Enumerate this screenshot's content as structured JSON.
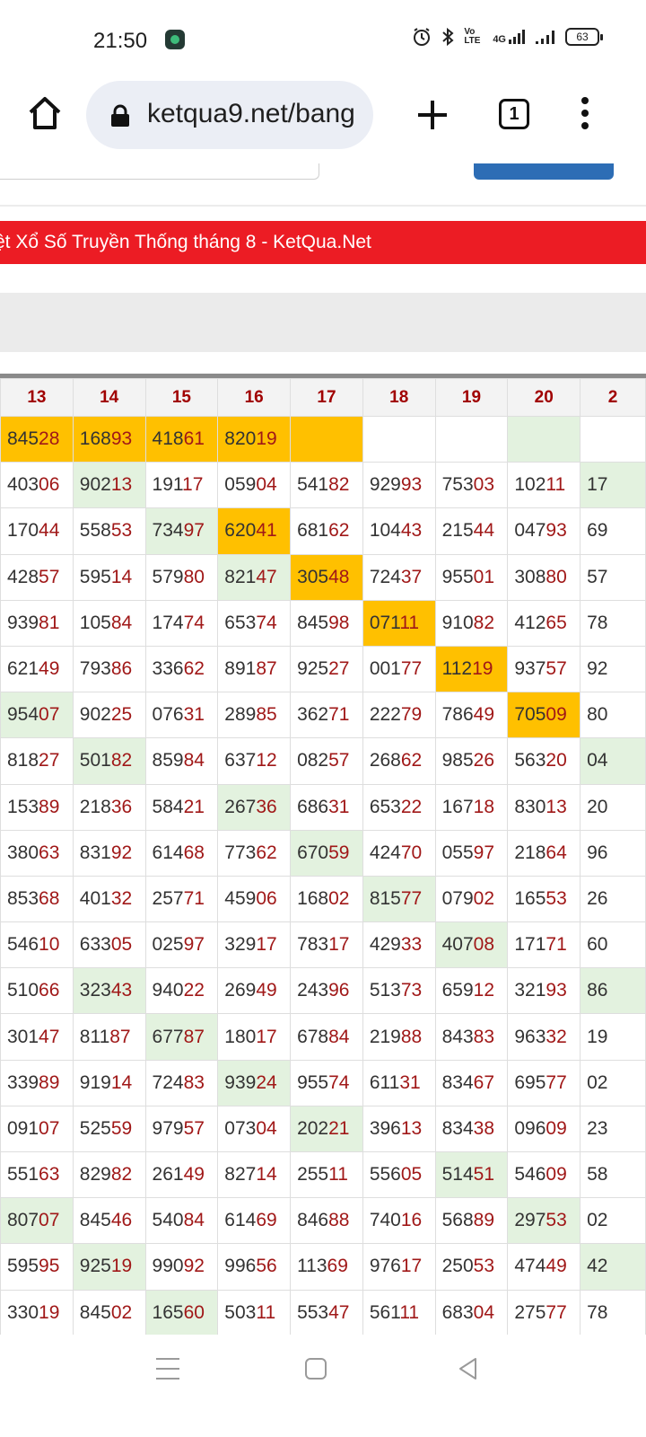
{
  "status_bar": {
    "time": "21:50",
    "network_label": "4G",
    "volte_label": "Vo LTE",
    "battery": "63",
    "icons": [
      "app-notification-icon",
      "alarm-icon",
      "bluetooth-icon",
      "volte-icon",
      "signal-4g-icon",
      "signal-icon",
      "battery-icon"
    ]
  },
  "toolbar": {
    "url": "ketqua9.net/bang",
    "tab_count": "1",
    "icons": [
      "home-icon",
      "lock-icon",
      "plus-icon",
      "tabs-icon",
      "menu-icon"
    ]
  },
  "banner": {
    "text": "ệt Xổ Số Truyền Thống tháng 8 - KetQua.Net",
    "color": "#ec1c24"
  },
  "colors": {
    "highlight_orange": "#ffc000",
    "highlight_green": "#e3f2df",
    "tail_digits": "#a01818",
    "header_text": "#a00000"
  },
  "table": {
    "headers": [
      "13",
      "14",
      "15",
      "16",
      "17",
      "18",
      "19",
      "20",
      "2"
    ],
    "rows": [
      [
        {
          "v": "84528",
          "h": "o"
        },
        {
          "v": "16893",
          "h": "o"
        },
        {
          "v": "41861",
          "h": "o"
        },
        {
          "v": "82019",
          "h": "o"
        },
        {
          "v": "",
          "h": "o"
        },
        {
          "v": "",
          "h": ""
        },
        {
          "v": "",
          "h": ""
        },
        {
          "v": "",
          "h": "g"
        },
        {
          "v": "",
          "h": ""
        }
      ],
      [
        {
          "v": "40306",
          "h": ""
        },
        {
          "v": "90213",
          "h": "g"
        },
        {
          "v": "19117",
          "h": ""
        },
        {
          "v": "05904",
          "h": ""
        },
        {
          "v": "54182",
          "h": ""
        },
        {
          "v": "92993",
          "h": ""
        },
        {
          "v": "75303",
          "h": ""
        },
        {
          "v": "10211",
          "h": ""
        },
        {
          "v": "17",
          "h": "g"
        }
      ],
      [
        {
          "v": "17044",
          "h": ""
        },
        {
          "v": "55853",
          "h": ""
        },
        {
          "v": "73497",
          "h": "g"
        },
        {
          "v": "62041",
          "h": "o"
        },
        {
          "v": "68162",
          "h": ""
        },
        {
          "v": "10443",
          "h": ""
        },
        {
          "v": "21544",
          "h": ""
        },
        {
          "v": "04793",
          "h": ""
        },
        {
          "v": "69",
          "h": ""
        }
      ],
      [
        {
          "v": "42857",
          "h": ""
        },
        {
          "v": "59514",
          "h": ""
        },
        {
          "v": "57980",
          "h": ""
        },
        {
          "v": "82147",
          "h": "g"
        },
        {
          "v": "30548",
          "h": "o"
        },
        {
          "v": "72437",
          "h": ""
        },
        {
          "v": "95501",
          "h": ""
        },
        {
          "v": "30880",
          "h": ""
        },
        {
          "v": "57",
          "h": ""
        }
      ],
      [
        {
          "v": "93981",
          "h": ""
        },
        {
          "v": "10584",
          "h": ""
        },
        {
          "v": "17474",
          "h": ""
        },
        {
          "v": "65374",
          "h": ""
        },
        {
          "v": "84598",
          "h": ""
        },
        {
          "v": "07111",
          "h": "o"
        },
        {
          "v": "91082",
          "h": ""
        },
        {
          "v": "41265",
          "h": ""
        },
        {
          "v": "78",
          "h": ""
        }
      ],
      [
        {
          "v": "62149",
          "h": ""
        },
        {
          "v": "79386",
          "h": ""
        },
        {
          "v": "33662",
          "h": ""
        },
        {
          "v": "89187",
          "h": ""
        },
        {
          "v": "92527",
          "h": ""
        },
        {
          "v": "00177",
          "h": ""
        },
        {
          "v": "11219",
          "h": "o"
        },
        {
          "v": "93757",
          "h": ""
        },
        {
          "v": "92",
          "h": ""
        }
      ],
      [
        {
          "v": "95407",
          "h": "g"
        },
        {
          "v": "90225",
          "h": ""
        },
        {
          "v": "07631",
          "h": ""
        },
        {
          "v": "28985",
          "h": ""
        },
        {
          "v": "36271",
          "h": ""
        },
        {
          "v": "22279",
          "h": ""
        },
        {
          "v": "78649",
          "h": ""
        },
        {
          "v": "70509",
          "h": "o"
        },
        {
          "v": "80",
          "h": ""
        }
      ],
      [
        {
          "v": "81827",
          "h": ""
        },
        {
          "v": "50182",
          "h": "g"
        },
        {
          "v": "85984",
          "h": ""
        },
        {
          "v": "63712",
          "h": ""
        },
        {
          "v": "08257",
          "h": ""
        },
        {
          "v": "26862",
          "h": ""
        },
        {
          "v": "98526",
          "h": ""
        },
        {
          "v": "56320",
          "h": ""
        },
        {
          "v": "04",
          "h": "g"
        }
      ],
      [
        {
          "v": "15389",
          "h": ""
        },
        {
          "v": "21836",
          "h": ""
        },
        {
          "v": "58421",
          "h": ""
        },
        {
          "v": "26736",
          "h": "g"
        },
        {
          "v": "68631",
          "h": ""
        },
        {
          "v": "65322",
          "h": ""
        },
        {
          "v": "16718",
          "h": ""
        },
        {
          "v": "83013",
          "h": ""
        },
        {
          "v": "20",
          "h": ""
        }
      ],
      [
        {
          "v": "38063",
          "h": ""
        },
        {
          "v": "83192",
          "h": ""
        },
        {
          "v": "61468",
          "h": ""
        },
        {
          "v": "77362",
          "h": ""
        },
        {
          "v": "67059",
          "h": "g"
        },
        {
          "v": "42470",
          "h": ""
        },
        {
          "v": "05597",
          "h": ""
        },
        {
          "v": "21864",
          "h": ""
        },
        {
          "v": "96",
          "h": ""
        }
      ],
      [
        {
          "v": "85368",
          "h": ""
        },
        {
          "v": "40132",
          "h": ""
        },
        {
          "v": "25771",
          "h": ""
        },
        {
          "v": "45906",
          "h": ""
        },
        {
          "v": "16802",
          "h": ""
        },
        {
          "v": "81577",
          "h": "g"
        },
        {
          "v": "07902",
          "h": ""
        },
        {
          "v": "16553",
          "h": ""
        },
        {
          "v": "26",
          "h": ""
        }
      ],
      [
        {
          "v": "54610",
          "h": ""
        },
        {
          "v": "63305",
          "h": ""
        },
        {
          "v": "02597",
          "h": ""
        },
        {
          "v": "32917",
          "h": ""
        },
        {
          "v": "78317",
          "h": ""
        },
        {
          "v": "42933",
          "h": ""
        },
        {
          "v": "40708",
          "h": "g"
        },
        {
          "v": "17171",
          "h": ""
        },
        {
          "v": "60",
          "h": ""
        }
      ],
      [
        {
          "v": "51066",
          "h": ""
        },
        {
          "v": "32343",
          "h": "g"
        },
        {
          "v": "94022",
          "h": ""
        },
        {
          "v": "26949",
          "h": ""
        },
        {
          "v": "24396",
          "h": ""
        },
        {
          "v": "51373",
          "h": ""
        },
        {
          "v": "65912",
          "h": ""
        },
        {
          "v": "32193",
          "h": ""
        },
        {
          "v": "86",
          "h": "g"
        }
      ],
      [
        {
          "v": "30147",
          "h": ""
        },
        {
          "v": "81187",
          "h": ""
        },
        {
          "v": "67787",
          "h": "g"
        },
        {
          "v": "18017",
          "h": ""
        },
        {
          "v": "67884",
          "h": ""
        },
        {
          "v": "21988",
          "h": ""
        },
        {
          "v": "84383",
          "h": ""
        },
        {
          "v": "96332",
          "h": ""
        },
        {
          "v": "19",
          "h": ""
        }
      ],
      [
        {
          "v": "33989",
          "h": ""
        },
        {
          "v": "91914",
          "h": ""
        },
        {
          "v": "72483",
          "h": ""
        },
        {
          "v": "93924",
          "h": "g"
        },
        {
          "v": "95574",
          "h": ""
        },
        {
          "v": "61131",
          "h": ""
        },
        {
          "v": "83467",
          "h": ""
        },
        {
          "v": "69577",
          "h": ""
        },
        {
          "v": "02",
          "h": ""
        }
      ],
      [
        {
          "v": "09107",
          "h": ""
        },
        {
          "v": "52559",
          "h": ""
        },
        {
          "v": "97957",
          "h": ""
        },
        {
          "v": "07304",
          "h": ""
        },
        {
          "v": "20221",
          "h": "g"
        },
        {
          "v": "39613",
          "h": ""
        },
        {
          "v": "83438",
          "h": ""
        },
        {
          "v": "09609",
          "h": ""
        },
        {
          "v": "23",
          "h": ""
        }
      ],
      [
        {
          "v": "55163",
          "h": ""
        },
        {
          "v": "82982",
          "h": ""
        },
        {
          "v": "26149",
          "h": ""
        },
        {
          "v": "82714",
          "h": ""
        },
        {
          "v": "25511",
          "h": ""
        },
        {
          "v": "55605",
          "h": ""
        },
        {
          "v": "51451",
          "h": "g"
        },
        {
          "v": "54609",
          "h": ""
        },
        {
          "v": "58",
          "h": ""
        }
      ],
      [
        {
          "v": "80707",
          "h": "g"
        },
        {
          "v": "84546",
          "h": ""
        },
        {
          "v": "54084",
          "h": ""
        },
        {
          "v": "61469",
          "h": ""
        },
        {
          "v": "84688",
          "h": ""
        },
        {
          "v": "74016",
          "h": ""
        },
        {
          "v": "56889",
          "h": ""
        },
        {
          "v": "29753",
          "h": "g"
        },
        {
          "v": "02",
          "h": ""
        }
      ],
      [
        {
          "v": "59595",
          "h": ""
        },
        {
          "v": "92519",
          "h": "g"
        },
        {
          "v": "99092",
          "h": ""
        },
        {
          "v": "99656",
          "h": ""
        },
        {
          "v": "11369",
          "h": ""
        },
        {
          "v": "97617",
          "h": ""
        },
        {
          "v": "25053",
          "h": ""
        },
        {
          "v": "47449",
          "h": ""
        },
        {
          "v": "42",
          "h": "g"
        }
      ],
      [
        {
          "v": "33019",
          "h": ""
        },
        {
          "v": "84502",
          "h": ""
        },
        {
          "v": "16560",
          "h": "g"
        },
        {
          "v": "50311",
          "h": ""
        },
        {
          "v": "55347",
          "h": ""
        },
        {
          "v": "56111",
          "h": ""
        },
        {
          "v": "68304",
          "h": ""
        },
        {
          "v": "27577",
          "h": ""
        },
        {
          "v": "78",
          "h": ""
        }
      ]
    ]
  },
  "nav_bar": {
    "icons": [
      "recents-menu-icon",
      "home-square-icon",
      "back-triangle-icon"
    ]
  }
}
